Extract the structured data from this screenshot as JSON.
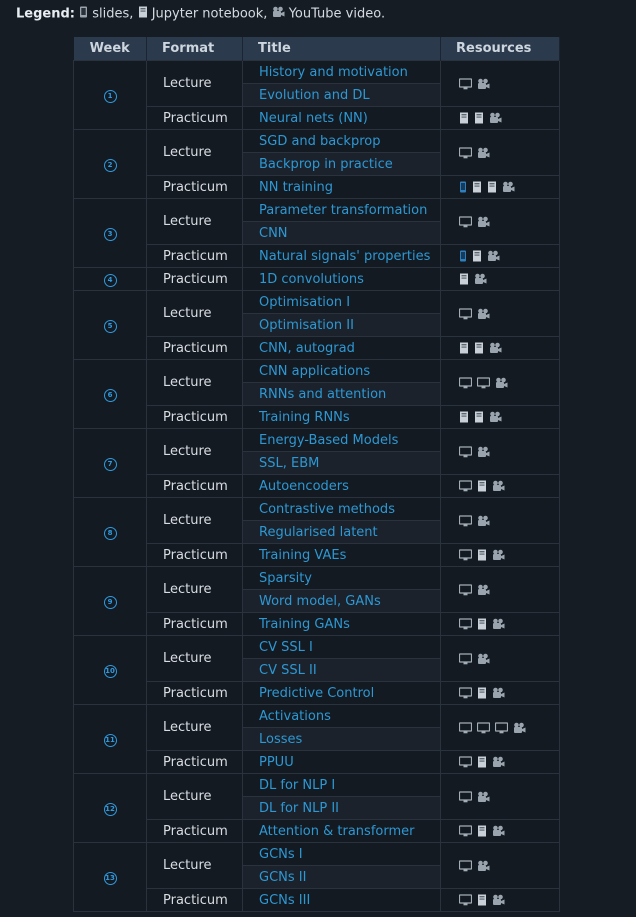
{
  "legend": {
    "label": "Legend:",
    "items": [
      {
        "icon": "slides-icon",
        "text": "slides,"
      },
      {
        "icon": "notebook-icon",
        "text": "Jupyter notebook,"
      },
      {
        "icon": "video-icon",
        "text": "YouTube video."
      }
    ]
  },
  "headers": {
    "week": "Week",
    "format": "Format",
    "title": "Title",
    "resources": "Resources"
  },
  "weeks": [
    {
      "num": "1",
      "rows": [
        {
          "format": "Lecture",
          "titles": [
            "History and motivation",
            "Evolution and DL"
          ],
          "resources": [
            "slides",
            "video"
          ]
        },
        {
          "format": "Practicum",
          "titles": [
            "Neural nets (NN)"
          ],
          "resources": [
            "notebook",
            "notebook",
            "video"
          ]
        }
      ]
    },
    {
      "num": "2",
      "rows": [
        {
          "format": "Lecture",
          "titles": [
            "SGD and backprop",
            "Backprop in practice"
          ],
          "resources": [
            "slides",
            "video"
          ]
        },
        {
          "format": "Practicum",
          "titles": [
            "NN training"
          ],
          "resources": [
            "phone",
            "notebook",
            "notebook",
            "video"
          ]
        }
      ]
    },
    {
      "num": "3",
      "rows": [
        {
          "format": "Lecture",
          "titles": [
            "Parameter transformation",
            "CNN"
          ],
          "resources": [
            "slides",
            "video"
          ]
        },
        {
          "format": "Practicum",
          "titles": [
            "Natural signals' properties"
          ],
          "resources": [
            "phone",
            "notebook",
            "video"
          ]
        }
      ]
    },
    {
      "num": "4",
      "rows": [
        {
          "format": "Practicum",
          "titles": [
            "1D convolutions"
          ],
          "resources": [
            "notebook",
            "video"
          ]
        }
      ]
    },
    {
      "num": "5",
      "rows": [
        {
          "format": "Lecture",
          "titles": [
            "Optimisation I",
            "Optimisation II"
          ],
          "resources": [
            "slides",
            "video"
          ]
        },
        {
          "format": "Practicum",
          "titles": [
            "CNN, autograd"
          ],
          "resources": [
            "notebook",
            "notebook",
            "video"
          ]
        }
      ]
    },
    {
      "num": "6",
      "rows": [
        {
          "format": "Lecture",
          "titles": [
            "CNN applications",
            "RNNs and attention"
          ],
          "resources": [
            "slides",
            "slides",
            "video"
          ]
        },
        {
          "format": "Practicum",
          "titles": [
            "Training RNNs"
          ],
          "resources": [
            "notebook",
            "notebook",
            "video"
          ]
        }
      ]
    },
    {
      "num": "7",
      "rows": [
        {
          "format": "Lecture",
          "titles": [
            "Energy-Based Models",
            "SSL, EBM"
          ],
          "resources": [
            "slides",
            "video"
          ]
        },
        {
          "format": "Practicum",
          "titles": [
            "Autoencoders"
          ],
          "resources": [
            "slides",
            "notebook",
            "video"
          ]
        }
      ]
    },
    {
      "num": "8",
      "rows": [
        {
          "format": "Lecture",
          "titles": [
            "Contrastive methods",
            "Regularised latent"
          ],
          "resources": [
            "slides",
            "video"
          ]
        },
        {
          "format": "Practicum",
          "titles": [
            "Training VAEs"
          ],
          "resources": [
            "slides",
            "notebook",
            "video"
          ]
        }
      ]
    },
    {
      "num": "9",
      "rows": [
        {
          "format": "Lecture",
          "titles": [
            "Sparsity",
            "Word model, GANs"
          ],
          "resources": [
            "slides",
            "video"
          ]
        },
        {
          "format": "Practicum",
          "titles": [
            "Training GANs"
          ],
          "resources": [
            "slides",
            "notebook",
            "video"
          ]
        }
      ]
    },
    {
      "num": "10",
      "rows": [
        {
          "format": "Lecture",
          "titles": [
            "CV SSL I",
            "CV SSL II"
          ],
          "resources": [
            "slides",
            "video"
          ]
        },
        {
          "format": "Practicum",
          "titles": [
            "Predictive Control"
          ],
          "resources": [
            "slides",
            "notebook",
            "video"
          ]
        }
      ]
    },
    {
      "num": "11",
      "rows": [
        {
          "format": "Lecture",
          "titles": [
            "Activations",
            "Losses"
          ],
          "resources": [
            "slides",
            "slides",
            "slides",
            "video"
          ]
        },
        {
          "format": "Practicum",
          "titles": [
            "PPUU"
          ],
          "resources": [
            "slides",
            "notebook",
            "video"
          ]
        }
      ]
    },
    {
      "num": "12",
      "rows": [
        {
          "format": "Lecture",
          "titles": [
            "DL for NLP I",
            "DL for NLP II"
          ],
          "resources": [
            "slides",
            "video"
          ]
        },
        {
          "format": "Practicum",
          "titles": [
            "Attention & transformer"
          ],
          "resources": [
            "slides",
            "notebook",
            "video"
          ]
        }
      ]
    },
    {
      "num": "13",
      "rows": [
        {
          "format": "Lecture",
          "titles": [
            "GCNs I",
            "GCNs II"
          ],
          "resources": [
            "slides",
            "video"
          ]
        },
        {
          "format": "Practicum",
          "titles": [
            "GCNs III"
          ],
          "resources": [
            "slides",
            "notebook",
            "video"
          ]
        }
      ]
    }
  ],
  "colors": {
    "link": "#2d98d4",
    "week_circle": "#2f9be0",
    "header_bg": "#2b3a4c",
    "page_bg": "#161c24"
  }
}
